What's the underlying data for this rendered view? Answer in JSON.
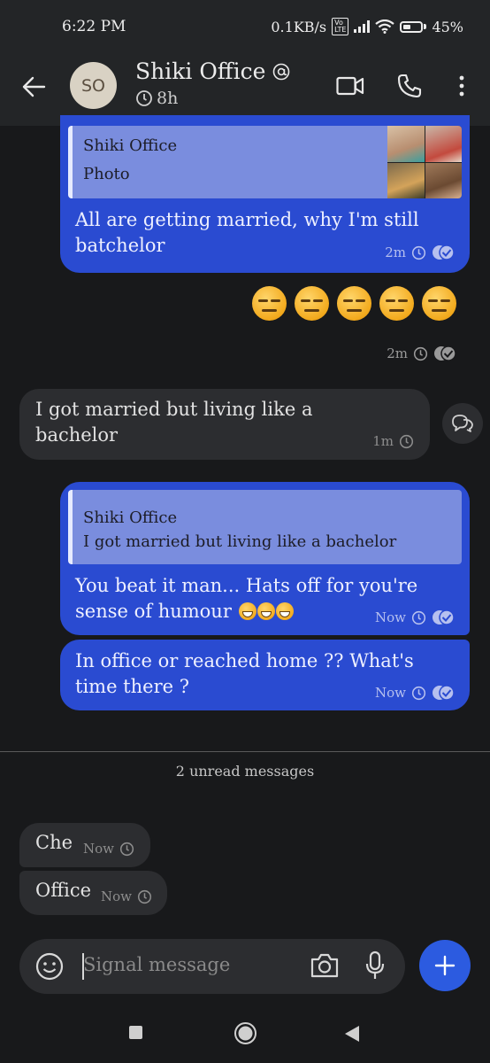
{
  "status_bar": {
    "time": "6:22 PM",
    "speed": "0.1KB/s",
    "volte": "Vo LTE",
    "battery": "45%",
    "battery_level": 0.45
  },
  "header": {
    "avatar_initials": "SO",
    "contact_name": "Shiki Office",
    "timer": "8h"
  },
  "messages": [
    {
      "direction": "outgoing",
      "quote_author": "Shiki Office",
      "quote_text": "Photo",
      "text": "All are getting married, why I'm still batchelor",
      "time": "2m"
    },
    {
      "direction": "outgoing",
      "text": "😑😑😑😑😑",
      "time": "2m"
    },
    {
      "direction": "incoming",
      "text": "I got married but living like a bachelor",
      "time": "1m"
    },
    {
      "direction": "outgoing",
      "quote_author": "Shiki Office",
      "quote_text": "I got married but living like a bachelor",
      "text": "You beat it man... Hats off for you're sense of humour 😄😄😄",
      "text_main": "You beat it man... Hats off for you're sense of humour",
      "time": "Now"
    },
    {
      "direction": "outgoing",
      "text": "In office or reached home ?? What's time there ?",
      "time": "Now"
    }
  ],
  "unread_divider": "2 unread messages",
  "unread_messages": [
    {
      "direction": "incoming",
      "text": "Che",
      "time": "Now"
    },
    {
      "direction": "incoming",
      "text": "Office",
      "time": "Now"
    }
  ],
  "composer": {
    "placeholder": "Signal message"
  },
  "colors": {
    "outgoing_bubble": "#2a4bd1",
    "incoming_bubble": "#2c2d30",
    "background": "#18191b",
    "accent": "#2c5be0"
  },
  "icons": [
    "back-arrow-icon",
    "timer-icon",
    "video-call-icon",
    "phone-icon",
    "more-icon",
    "sent-check-icon",
    "reply-icon",
    "emoji-icon",
    "camera-icon",
    "mic-icon",
    "plus-icon",
    "nav-recents-icon",
    "nav-home-icon",
    "nav-back-icon"
  ]
}
